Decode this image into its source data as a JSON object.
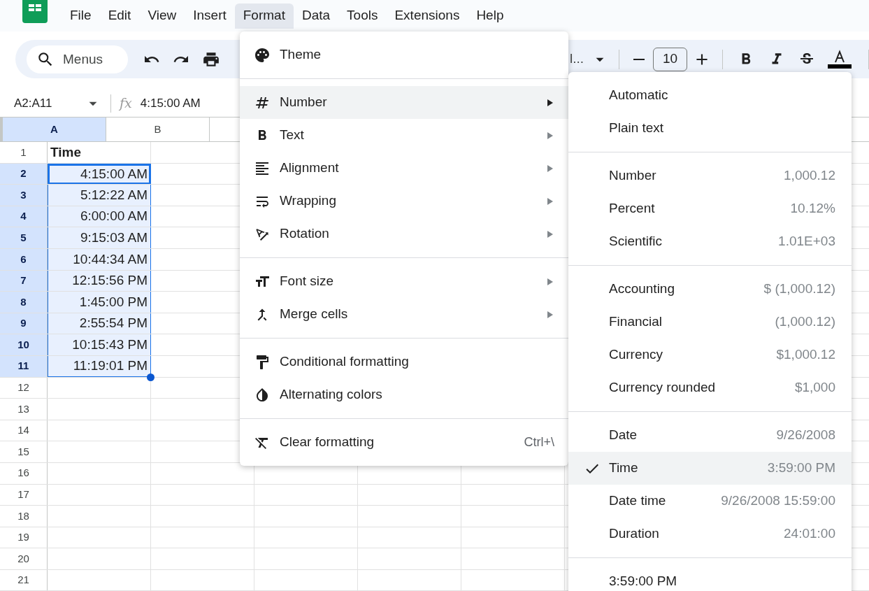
{
  "menubar": {
    "items": [
      {
        "label": "File",
        "selected": false
      },
      {
        "label": "Edit",
        "selected": false
      },
      {
        "label": "View",
        "selected": false
      },
      {
        "label": "Insert",
        "selected": false
      },
      {
        "label": "Format",
        "selected": true
      },
      {
        "label": "Data",
        "selected": false
      },
      {
        "label": "Tools",
        "selected": false
      },
      {
        "label": "Extensions",
        "selected": false
      },
      {
        "label": "Help",
        "selected": false
      }
    ]
  },
  "toolbar": {
    "search_placeholder": "Menus",
    "font_name": "l...",
    "font_size": "10"
  },
  "formula_bar": {
    "name_box": "A2:A11",
    "fx": "fx",
    "formula": "4:15:00 AM"
  },
  "grid": {
    "columns": [
      {
        "label": "A",
        "selected": true
      },
      {
        "label": "B",
        "selected": false
      }
    ],
    "rows": [
      {
        "number": "1",
        "selected": false,
        "cells": [
          {
            "text": "Time",
            "bold": true,
            "active": false
          }
        ]
      },
      {
        "number": "2",
        "selected": true,
        "cells": [
          {
            "text": "4:15:00 AM",
            "bold": false,
            "active": true
          }
        ]
      },
      {
        "number": "3",
        "selected": true,
        "cells": [
          {
            "text": "5:12:22 AM",
            "bold": false,
            "active": false
          }
        ]
      },
      {
        "number": "4",
        "selected": true,
        "cells": [
          {
            "text": "6:00:00 AM",
            "bold": false,
            "active": false
          }
        ]
      },
      {
        "number": "5",
        "selected": true,
        "cells": [
          {
            "text": "9:15:03 AM",
            "bold": false,
            "active": false
          }
        ]
      },
      {
        "number": "6",
        "selected": true,
        "cells": [
          {
            "text": "10:44:34 AM",
            "bold": false,
            "active": false
          }
        ]
      },
      {
        "number": "7",
        "selected": true,
        "cells": [
          {
            "text": "12:15:56 PM",
            "bold": false,
            "active": false
          }
        ]
      },
      {
        "number": "8",
        "selected": true,
        "cells": [
          {
            "text": "1:45:00 PM",
            "bold": false,
            "active": false
          }
        ]
      },
      {
        "number": "9",
        "selected": true,
        "cells": [
          {
            "text": "2:55:54 PM",
            "bold": false,
            "active": false
          }
        ]
      },
      {
        "number": "10",
        "selected": true,
        "cells": [
          {
            "text": "10:15:43 PM",
            "bold": false,
            "active": false
          }
        ]
      },
      {
        "number": "11",
        "selected": true,
        "cells": [
          {
            "text": "11:19:01 PM",
            "bold": false,
            "active": false
          }
        ]
      },
      {
        "number": "12",
        "selected": false,
        "cells": []
      },
      {
        "number": "13",
        "selected": false,
        "cells": []
      },
      {
        "number": "14",
        "selected": false,
        "cells": []
      },
      {
        "number": "15",
        "selected": false,
        "cells": []
      },
      {
        "number": "16",
        "selected": false,
        "cells": []
      },
      {
        "number": "17",
        "selected": false,
        "cells": []
      },
      {
        "number": "18",
        "selected": false,
        "cells": []
      },
      {
        "number": "19",
        "selected": false,
        "cells": []
      },
      {
        "number": "20",
        "selected": false,
        "cells": []
      },
      {
        "number": "21",
        "selected": false,
        "cells": []
      }
    ]
  },
  "format_menu": {
    "sections": [
      [
        {
          "label": "Theme",
          "selected": false,
          "has_submenu": false
        }
      ],
      [
        {
          "label": "Number",
          "selected": true,
          "has_submenu": true
        },
        {
          "label": "Text",
          "selected": false,
          "has_submenu": true
        },
        {
          "label": "Alignment",
          "selected": false,
          "has_submenu": true
        },
        {
          "label": "Wrapping",
          "selected": false,
          "has_submenu": true
        },
        {
          "label": "Rotation",
          "selected": false,
          "has_submenu": true
        }
      ],
      [
        {
          "label": "Font size",
          "selected": false,
          "has_submenu": true
        },
        {
          "label": "Merge cells",
          "selected": false,
          "has_submenu": true
        }
      ],
      [
        {
          "label": "Conditional formatting",
          "selected": false,
          "has_submenu": false
        },
        {
          "label": "Alternating colors",
          "selected": false,
          "has_submenu": false
        }
      ],
      [
        {
          "label": "Clear formatting",
          "selected": false,
          "has_submenu": false,
          "shortcut": "Ctrl+\\"
        }
      ]
    ]
  },
  "number_submenu": {
    "sections": [
      [
        {
          "label": "Automatic",
          "checked": false,
          "selected": false
        },
        {
          "label": "Plain text",
          "checked": false,
          "selected": false
        }
      ],
      [
        {
          "label": "Number",
          "example": "1,000.12",
          "checked": false,
          "selected": false
        },
        {
          "label": "Percent",
          "example": "10.12%",
          "checked": false,
          "selected": false
        },
        {
          "label": "Scientific",
          "example": "1.01E+03",
          "checked": false,
          "selected": false
        }
      ],
      [
        {
          "label": "Accounting",
          "example": "$ (1,000.12)",
          "checked": false,
          "selected": false
        },
        {
          "label": "Financial",
          "example": "(1,000.12)",
          "checked": false,
          "selected": false
        },
        {
          "label": "Currency",
          "example": "$1,000.12",
          "checked": false,
          "selected": false
        },
        {
          "label": "Currency rounded",
          "example": "$1,000",
          "checked": false,
          "selected": false
        }
      ],
      [
        {
          "label": "Date",
          "example": "9/26/2008",
          "checked": false,
          "selected": false
        },
        {
          "label": "Time",
          "example": "3:59:00 PM",
          "checked": true,
          "selected": true
        },
        {
          "label": "Date time",
          "example": "9/26/2008 15:59:00",
          "checked": false,
          "selected": false
        },
        {
          "label": "Duration",
          "example": "24:01:00",
          "checked": false,
          "selected": false
        }
      ],
      [
        {
          "label": "3:59:00 PM",
          "checked": false,
          "selected": false
        }
      ]
    ]
  }
}
